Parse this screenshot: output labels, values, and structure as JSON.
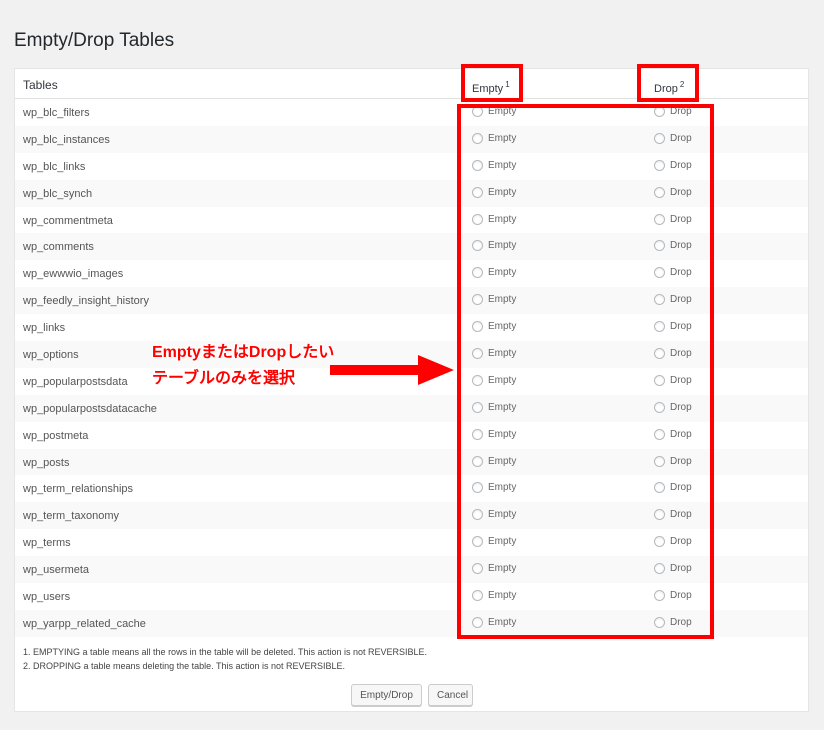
{
  "page": {
    "title": "Empty/Drop Tables"
  },
  "table": {
    "header": {
      "tables": "Tables",
      "empty": "Empty",
      "empty_note": "1",
      "drop": "Drop",
      "drop_note": "2"
    },
    "empty_label": "Empty",
    "drop_label": "Drop",
    "rows": [
      "wp_blc_filters",
      "wp_blc_instances",
      "wp_blc_links",
      "wp_blc_synch",
      "wp_commentmeta",
      "wp_comments",
      "wp_ewwwio_images",
      "wp_feedly_insight_history",
      "wp_links",
      "wp_options",
      "wp_popularpostsdata",
      "wp_popularpostsdatacache",
      "wp_postmeta",
      "wp_posts",
      "wp_term_relationships",
      "wp_term_taxonomy",
      "wp_terms",
      "wp_usermeta",
      "wp_users",
      "wp_yarpp_related_cache"
    ]
  },
  "notes": [
    "1. EMPTYING a table means all the rows in the table will be deleted. This action is not REVERSIBLE.",
    "2. DROPPING a table means deleting the table. This action is not REVERSIBLE."
  ],
  "buttons": {
    "submit": "Empty/Drop",
    "cancel": "Cancel"
  },
  "annotation": {
    "line1": "EmptyまたはDropしたい",
    "line2": "テーブルのみを選択"
  },
  "colors": {
    "highlight": "#ff0000",
    "background": "#f1f1f1"
  }
}
